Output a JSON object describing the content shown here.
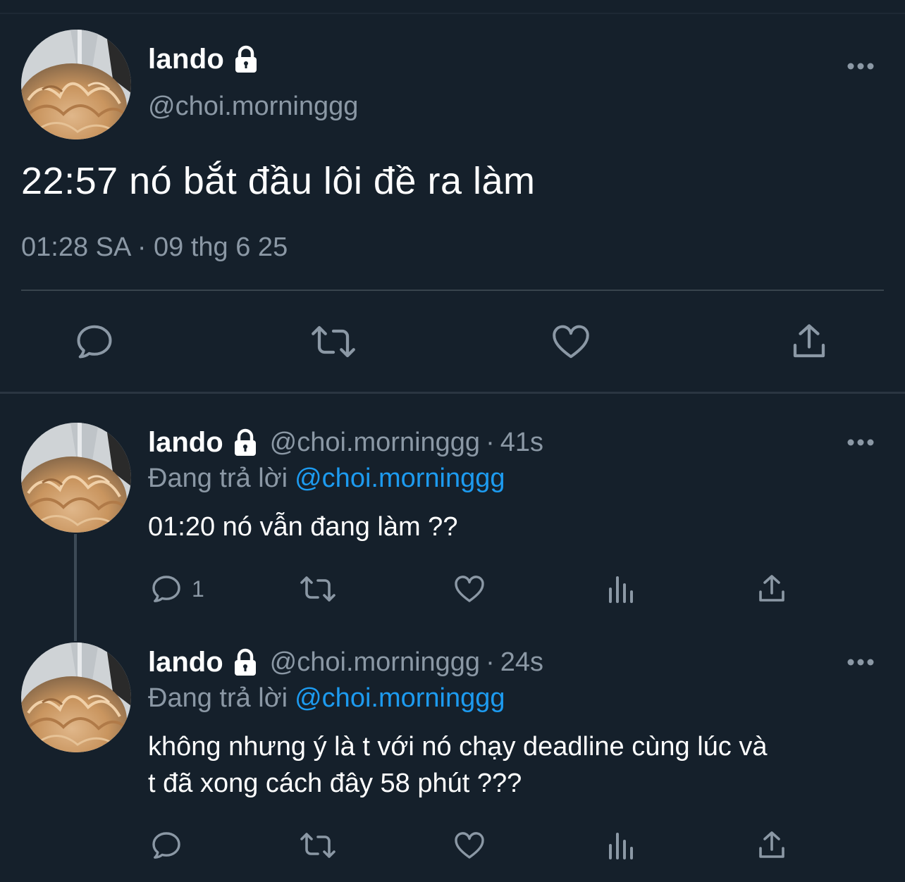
{
  "main_tweet": {
    "name": "lando",
    "handle": "@choi.morninggg",
    "text": "22:57 nó bắt đầu lôi đề ra làm",
    "time": "01:28 SA",
    "separator": "·",
    "date": "09 thg 6 25"
  },
  "replies": [
    {
      "name": "lando",
      "handle": "@choi.morninggg",
      "separator": "·",
      "time": "41s",
      "replying_label": "Đang trả lời",
      "replying_to": "@choi.morninggg",
      "text": "01:20 nó vẫn đang làm ??",
      "reply_count": "1"
    },
    {
      "name": "lando",
      "handle": "@choi.morninggg",
      "separator": "·",
      "time": "24s",
      "replying_label": "Đang trả lời",
      "replying_to": "@choi.morninggg",
      "text_line1": "không nhưng ý là t với nó chạy deadline cùng lúc và",
      "text_line2": "t đã xong cách đây 58 phút ???",
      "reply_count": ""
    }
  ],
  "colors": {
    "background": "#15202b",
    "secondary_text": "#8b98a5",
    "accent": "#1d9bf0",
    "divider": "#38444d"
  },
  "icons": [
    "lock-icon",
    "more-icon",
    "reply-icon",
    "retweet-icon",
    "like-icon",
    "share-icon",
    "views-icon"
  ]
}
